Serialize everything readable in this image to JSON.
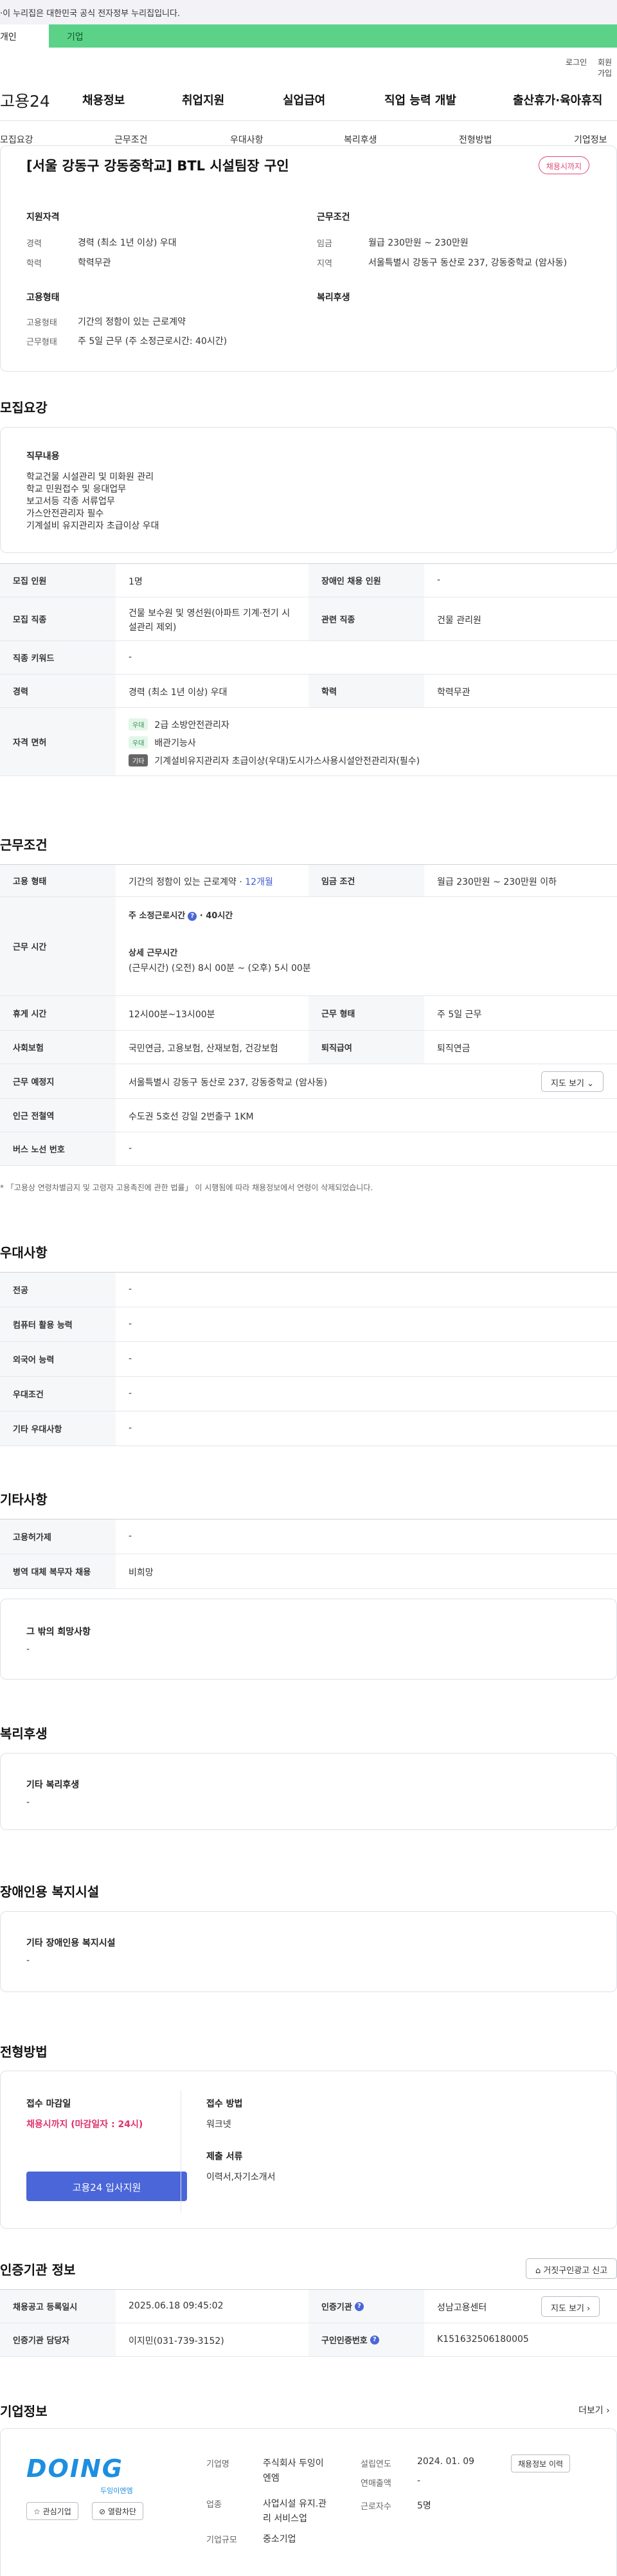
{
  "gov_banner": "·이 누리집은 대한민국 공식 전자정부 누리집입니다.",
  "user_tabs": {
    "individual": "개인",
    "corporate": "기업"
  },
  "util": {
    "login": "로그인",
    "signup": "회원가입"
  },
  "logo": "고용24",
  "gnb": [
    "채용정보",
    "취업지원",
    "실업급여",
    "직업 능력 개발",
    "출산휴가·육아휴직"
  ],
  "snb": [
    "모집요강",
    "근무조건",
    "우대사항",
    "복리후생",
    "전형방법",
    "기업정보"
  ],
  "job": {
    "title": "[서울 강동구 강동중학교] BTL 시설팀장 구인",
    "status_badge": "채용시까지",
    "qual_h": "지원자격",
    "cond_h": "근무조건",
    "exp_k": "경력",
    "exp_v": "경력 (최소 1년 이상) 우대",
    "edu_k": "학력",
    "edu_v": "학력무관",
    "wage_k": "임금",
    "wage_v": "월급 230만원 ~ 230만원",
    "area_k": "지역",
    "area_v": "서울특별시 강동구 동산로 237, 강동중학교 (암사동)",
    "emp_h": "고용형태",
    "welfare_h": "복리후생",
    "emptype_k": "고용형태",
    "emptype_v": "기간의 정함이 있는 근로계약",
    "worktype_k": "근무형태",
    "worktype_v": "주 5일 근무 (주 소정근로시간: 40시간)"
  },
  "recruit": {
    "heading": "모집요강",
    "duty_h": "직무내용",
    "duty_lines": [
      "학교건물 시설관리 및 미화원 관리",
      "학교 민원접수 및 응대업무",
      "보고서등 각종 서류업무",
      "가스안전관리자 필수",
      "기계설비 유지관리자 초급이상 우대"
    ],
    "count_k": "모집 인원",
    "count_v": "1명",
    "disabled_k": "장애인 채용 인원",
    "disabled_v": "-",
    "job_k": "모집 직종",
    "job_v1": "건물 보수원 및 영선원(아파트 기계·전기 시",
    "job_v2": "설관리 제외)",
    "rel_k": "관련 직종",
    "rel_v": "건물 관리원",
    "kw_k": "직종 키워드",
    "kw_v": "-",
    "exp_k": "경력",
    "exp_v": "경력 (최소 1년 이상) 우대",
    "edu_k": "학력",
    "edu_v": "학력무관",
    "license_k": "자격 면허",
    "licenses": [
      {
        "tag": "우대",
        "name": "2급 소방안전관리자"
      },
      {
        "tag": "우대",
        "name": "배관기능사"
      },
      {
        "tag": "기타",
        "name": "기계설비유지관리자 초급이상(우대)도시가스사용시설안전관리자(필수)"
      }
    ]
  },
  "work": {
    "heading": "근무조건",
    "emp_k": "고용 형태",
    "emp_v": "기간의 정함이 있는 근로계약 · ",
    "emp_months": "12개월",
    "wage_k": "임금 조건",
    "wage_v": "월급 230만원 ~ 230만원 이하",
    "time_k": "근무 시간",
    "weekly_label": "주 소정근로시간",
    "weekly_value": "· 40시간",
    "detail_label": "상세 근무시간",
    "detail_value": "(근무시간) (오전) 8시 00분 ~ (오후) 5시 00분",
    "rest_k": "휴게 시간",
    "rest_v": "12시00분~13시00분",
    "form_k": "근무 형태",
    "form_v": "주 5일 근무",
    "ins_k": "사회보험",
    "ins_v": "국민연금, 고용보험, 산재보험, 건강보험",
    "sev_k": "퇴직급여",
    "sev_v": "퇴직연금",
    "place_k": "근무 예정지",
    "place_v": "서울특별시 강동구 동산로 237, 강동중학교 (암사동)",
    "map_btn": "지도 보기",
    "station_k": "인근 전철역",
    "station_v": "수도권 5호선 강일 2번출구 1KM",
    "bus_k": "버스 노선 번호",
    "bus_v": "-",
    "note": "* 「고용상 연령차별금지 및 고령자 고용촉진에 관한 법률」 이 시행됨에 따라 채용정보에서 연령이 삭제되었습니다."
  },
  "pref": {
    "heading": "우대사항",
    "rows": [
      {
        "k": "전공",
        "v": "-"
      },
      {
        "k": "컴퓨터 활용 능력",
        "v": "-"
      },
      {
        "k": "외국어 능력",
        "v": "-"
      },
      {
        "k": "우대조건",
        "v": "-"
      },
      {
        "k": "기타 우대사항",
        "v": "-"
      }
    ]
  },
  "etc": {
    "heading": "기타사항",
    "rows": [
      {
        "k": "고용허가제",
        "v": "-"
      },
      {
        "k": "병역 대체 복무자 채용",
        "v": "비희망"
      }
    ],
    "other_h": "그 밖의 희망사항",
    "other_v": "-"
  },
  "welfare": {
    "heading": "복리후생",
    "box_h": "기타 복리후생",
    "box_v": "-"
  },
  "facility": {
    "heading": "장애인용 복지시설",
    "box_h": "기타 장애인용 복지시설",
    "box_v": "-"
  },
  "selection": {
    "heading": "전형방법",
    "deadline_h": "접수 마감일",
    "deadline_v": "채용시까지 (마감일자 : 24시)",
    "apply_btn": "고용24 입사지원",
    "method_h": "접수 방법",
    "method_v": "워크넷",
    "docs_h": "제출 서류",
    "docs_v": "이력서,자기소개서"
  },
  "cert": {
    "heading": "인증기관 정보",
    "report_btn": "거짓구인광고 신고",
    "reg_k": "채용공고 등록일시",
    "reg_v": "2025.06.18 09:45:02",
    "agency_k": "인증기관",
    "agency_v": "성남고용센터",
    "map_btn": "지도 보기",
    "manager_k": "인증기관 담당자",
    "manager_v": "이지민(031-739-3152)",
    "num_k": "구인인증번호",
    "num_v": "K151632506180005"
  },
  "company": {
    "heading": "기업정보",
    "more": "더보기 ›",
    "logo_text": "DOING",
    "logo_sub": "두잉이엔엠",
    "fav_btn": "관심기업",
    "block_btn": "열람차단",
    "name_k": "기업명",
    "name_v1": "주식회사 두잉이",
    "name_v2": "엔엠",
    "est_k": "설립연도",
    "est_v": "2024. 01. 09",
    "sales_k": "연매출액",
    "sales_v": "-",
    "ind_k": "업종",
    "ind_v1": "사업시설 유지.관",
    "ind_v2": "리 서비스업",
    "staff_k": "근로자수",
    "staff_v": "5명",
    "size_k": "기업규모",
    "size_v": "중소기업",
    "jobs_btn": "채용정보 이력"
  }
}
